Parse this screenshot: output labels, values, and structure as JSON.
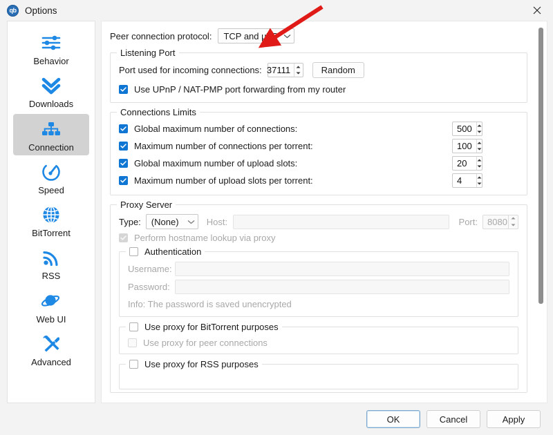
{
  "window": {
    "title": "Options",
    "logo_text": "qb",
    "close_label": "×"
  },
  "sidebar": {
    "items": [
      {
        "label": "Behavior",
        "icon": "sliders-icon",
        "selected": false
      },
      {
        "label": "Downloads",
        "icon": "chevrons-down-icon",
        "selected": false
      },
      {
        "label": "Connection",
        "icon": "network-tree-icon",
        "selected": true
      },
      {
        "label": "Speed",
        "icon": "speedometer-icon",
        "selected": false
      },
      {
        "label": "BitTorrent",
        "icon": "globe-icon",
        "selected": false
      },
      {
        "label": "RSS",
        "icon": "rss-icon",
        "selected": false
      },
      {
        "label": "Web UI",
        "icon": "planet-icon",
        "selected": false
      },
      {
        "label": "Advanced",
        "icon": "tools-icon",
        "selected": false
      }
    ]
  },
  "connection": {
    "peer_protocol_label": "Peer connection protocol:",
    "peer_protocol_value": "TCP and µTP",
    "listening_port": {
      "title": "Listening Port",
      "port_label": "Port used for incoming connections:",
      "port_value": "37111",
      "random_button": "Random",
      "upnp_label": "Use UPnP / NAT-PMP port forwarding from my router",
      "upnp_checked": true
    },
    "connections_limits": {
      "title": "Connections Limits",
      "rows": [
        {
          "label": "Global maximum number of connections:",
          "value": "500",
          "checked": true
        },
        {
          "label": "Maximum number of connections per torrent:",
          "value": "100",
          "checked": true
        },
        {
          "label": "Global maximum number of upload slots:",
          "value": "20",
          "checked": true
        },
        {
          "label": "Maximum number of upload slots per torrent:",
          "value": "4",
          "checked": true
        }
      ]
    },
    "proxy_server": {
      "title": "Proxy Server",
      "type_label": "Type:",
      "type_value": "(None)",
      "host_label": "Host:",
      "host_value": "",
      "port_label": "Port:",
      "port_value": "8080",
      "hostname_lookup_label": "Perform hostname lookup via proxy",
      "hostname_lookup_checked": true,
      "authentication": {
        "title": "Authentication",
        "checked": false,
        "username_label": "Username:",
        "username_value": "",
        "password_label": "Password:",
        "password_value": "",
        "info": "Info: The password is saved unencrypted"
      },
      "use_proxy_bittorrent_label": "Use proxy for BitTorrent purposes",
      "use_proxy_bittorrent_checked": false,
      "use_proxy_peer_label": "Use proxy for peer connections",
      "use_proxy_peer_checked": false,
      "use_proxy_rss_label": "Use proxy for RSS purposes",
      "use_proxy_rss_checked": false
    }
  },
  "footer": {
    "ok": "OK",
    "cancel": "Cancel",
    "apply": "Apply"
  },
  "annotation": {
    "arrow_color": "#e01b17"
  },
  "colors": {
    "accent_blue": "#1e88e5",
    "checkbox_blue": "#0f76d3",
    "selected_bg": "#d2d2d2"
  }
}
